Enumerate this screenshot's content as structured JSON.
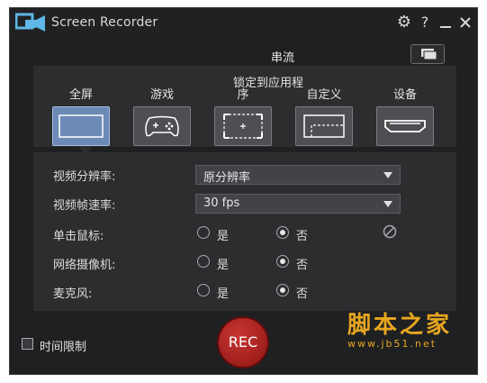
{
  "window": {
    "title": "Screen Recorder"
  },
  "titlebar": {
    "settings_icon": "gear-icon",
    "help_icon": "help-icon",
    "help_glyph": "?",
    "minimize_icon": "minimize-icon",
    "close_icon": "close-icon"
  },
  "stream": {
    "label": "串流",
    "button_icon": "stream-icon"
  },
  "modes": {
    "lock_label": "锁定到应用程",
    "tabs": [
      {
        "label": "全屏",
        "icon": "fullscreen-icon",
        "active": true
      },
      {
        "label": "游戏",
        "icon": "gamepad-icon",
        "active": false
      },
      {
        "label": "序",
        "icon": "app-window-icon",
        "active": false
      },
      {
        "label": "自定义",
        "icon": "custom-region-icon",
        "active": false
      },
      {
        "label": "设备",
        "icon": "hdmi-icon",
        "active": false
      }
    ]
  },
  "settings": {
    "resolution": {
      "label": "视频分辨率:",
      "value": "原分辨率"
    },
    "framerate": {
      "label": "视频帧速率:",
      "value": "30 fps"
    },
    "click": {
      "label": "单击鼠标:",
      "yes": "是",
      "no": "否",
      "selected": "no"
    },
    "webcam": {
      "label": "网络摄像机:",
      "yes": "是",
      "no": "否",
      "selected": "no"
    },
    "mic": {
      "label": "麦克风:",
      "yes": "是",
      "no": "否",
      "selected": "no"
    }
  },
  "footer": {
    "time_limit_label": "时间限制",
    "time_limit_checked": false,
    "rec_label": "REC"
  },
  "watermark": {
    "line1": "脚本之家",
    "line2": "www.jb51.net"
  },
  "colors": {
    "accent_active": "#6d8ab6",
    "rec_red": "#b3201d",
    "watermark": "#e8a61f"
  }
}
